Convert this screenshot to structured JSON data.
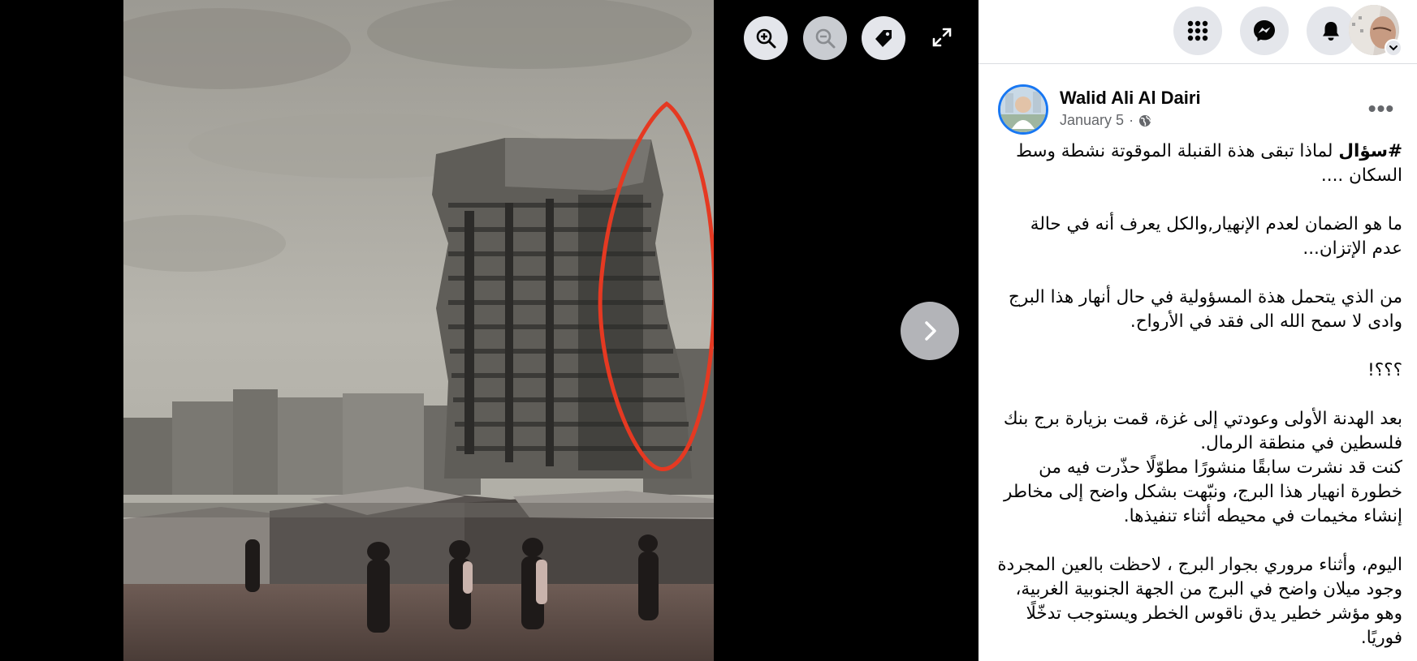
{
  "viewer": {
    "photo_description_icon": "photo",
    "controls": [
      {
        "name": "zoom-in-icon"
      },
      {
        "name": "zoom-out-icon"
      },
      {
        "name": "tag-icon"
      },
      {
        "name": "fullscreen-icon"
      },
      {
        "name": "chevron-right-icon"
      }
    ]
  },
  "topbar": {
    "icons": [
      "menu-grid-icon",
      "messenger-icon",
      "bell-icon",
      "chevron-down-icon"
    ]
  },
  "post": {
    "author": "Walid Ali Al Dairi",
    "date": "January 5",
    "separator": "·",
    "privacy_icon": "globe-icon",
    "more": "•••",
    "hashtag": "#سؤال",
    "paragraphs": [
      "لماذا تبقى هذة القنبلة الموقوتة نشطة وسط السكان ....",
      "ما هو الضمان لعدم الإنهيار,والكل يعرف أنه في حالة عدم الإتزان...",
      "من الذي يتحمل هذة المسؤولية في حال أنهار هذا البرج وادى لا سمح الله الى فقد في الأرواح.",
      "؟؟؟!",
      "بعد الهدنة الأولى وعودتي إلى غزة، قمت بزيارة برج بنك فلسطين في منطقة الرمال.",
      "كنت قد نشرت سابقًا منشورًا مطوّلًا حذّرت فيه من خطورة انهيار هذا البرج، ونبّهت بشكل واضح إلى مخاطر إنشاء مخيمات في محيطه أثناء تنفيذها.",
      "اليوم، وأثناء مروري بجوار البرج ، لاحظت بالعين المجردة وجود ميلان واضح في البرج من الجهة الجنوبية الغربية، وهو مؤشر خطير يدق ناقوس الخطر ويستوجب تدخّلًا فوريًا."
    ]
  }
}
